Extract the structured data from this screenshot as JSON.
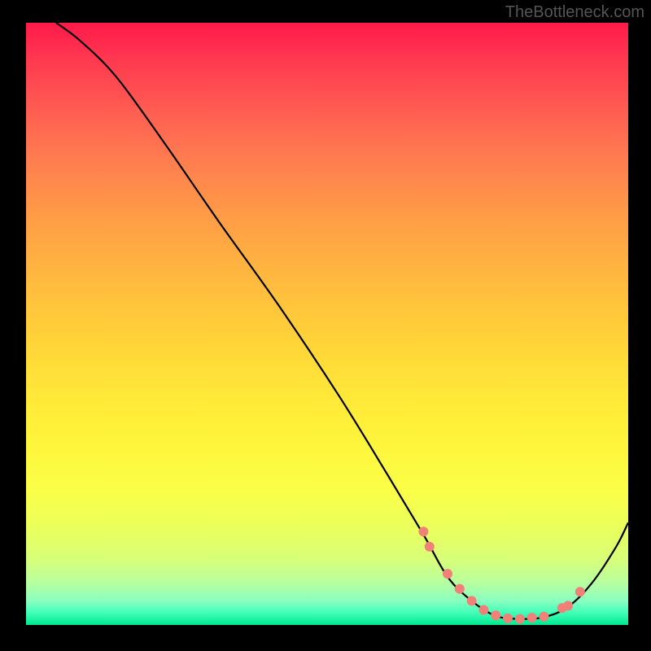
{
  "attribution": "TheBottleneck.com",
  "chart_data": {
    "type": "line",
    "title": "",
    "xlabel": "",
    "ylabel": "",
    "xlim": [
      0,
      100
    ],
    "ylim": [
      0,
      100
    ],
    "series": [
      {
        "name": "bottleneck-curve",
        "x_norm": [
          0.05,
          0.09,
          0.15,
          0.23,
          0.32,
          0.42,
          0.52,
          0.6,
          0.66,
          0.7,
          0.74,
          0.78,
          0.82,
          0.86,
          0.9,
          0.94,
          0.98,
          1.0
        ],
        "y_norm": [
          1.0,
          0.97,
          0.91,
          0.8,
          0.67,
          0.53,
          0.38,
          0.25,
          0.15,
          0.08,
          0.04,
          0.015,
          0.01,
          0.013,
          0.03,
          0.07,
          0.13,
          0.17
        ],
        "color": "#000"
      }
    ],
    "markers": {
      "name": "highlight-dots",
      "x_norm": [
        0.66,
        0.67,
        0.7,
        0.72,
        0.74,
        0.76,
        0.78,
        0.8,
        0.82,
        0.84,
        0.86,
        0.89,
        0.9,
        0.92
      ],
      "y_norm": [
        0.155,
        0.13,
        0.085,
        0.06,
        0.04,
        0.025,
        0.016,
        0.011,
        0.01,
        0.012,
        0.014,
        0.028,
        0.032,
        0.055
      ],
      "color": "#f08078",
      "radius": 6
    }
  }
}
